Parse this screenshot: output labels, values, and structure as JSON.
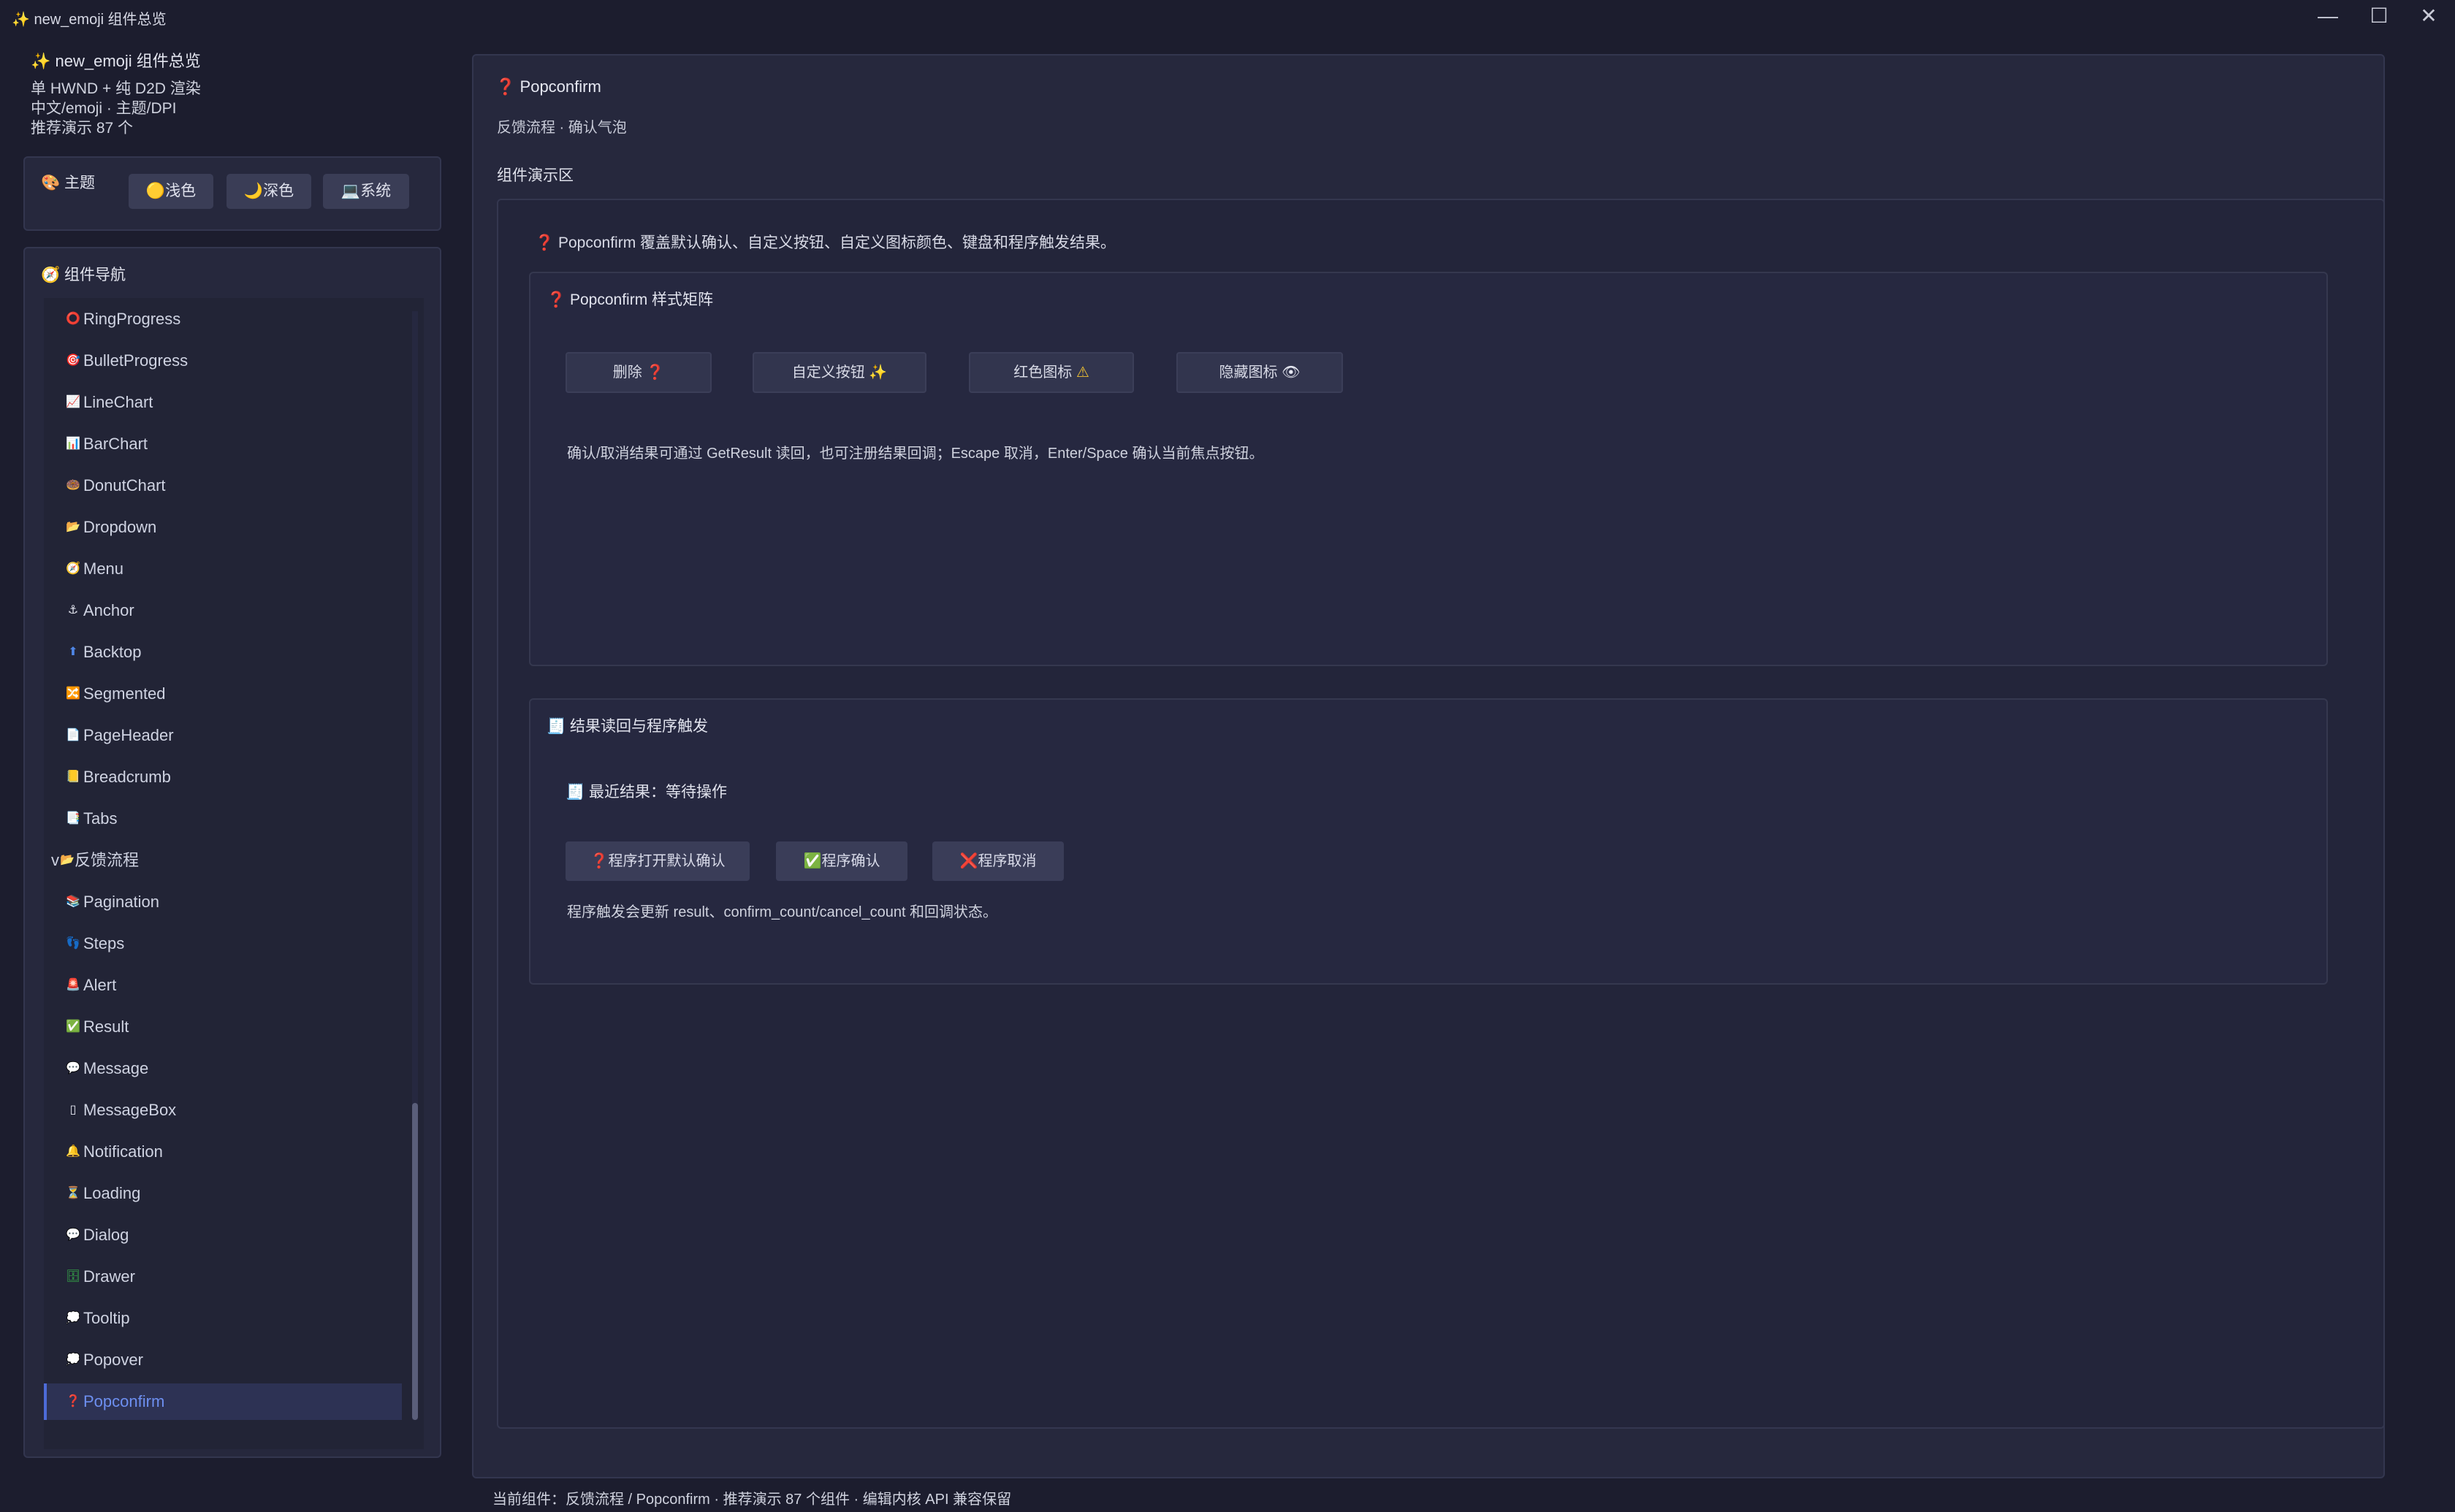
{
  "window": {
    "title": "new_emoji 组件总览",
    "title_icon": "✨",
    "controls": {
      "minimize": "—",
      "maximize": "☐",
      "close": "✕"
    }
  },
  "sidebar": {
    "app_title": "new_emoji 组件总览",
    "app_icon": "✨",
    "info_lines": [
      "单 HWND + 纯 D2D 渲染",
      "中文/emoji · 主题/DPI",
      "推荐演示 87 个"
    ],
    "theme": {
      "label": "主题",
      "icon": "🎨",
      "buttons": [
        {
          "label": "浅色",
          "icon": "🟡"
        },
        {
          "label": "深色",
          "icon": "🌙"
        },
        {
          "label": "系统",
          "icon": "💻"
        }
      ]
    },
    "nav": {
      "title": "组件导航",
      "icon": "🧭",
      "items": [
        {
          "label": "RingProgress",
          "icon": "⭕"
        },
        {
          "label": "BulletProgress",
          "icon": "🎯"
        },
        {
          "label": "LineChart",
          "icon": "📈"
        },
        {
          "label": "BarChart",
          "icon": "📊"
        },
        {
          "label": "DonutChart",
          "icon": "🍩"
        },
        {
          "label": "Dropdown",
          "icon": "📂"
        },
        {
          "label": "Menu",
          "icon": "🧭"
        },
        {
          "label": "Anchor",
          "icon": "⚓"
        },
        {
          "label": "Backtop",
          "icon": "⬆"
        },
        {
          "label": "Segmented",
          "icon": "🔀"
        },
        {
          "label": "PageHeader",
          "icon": "📄"
        },
        {
          "label": "Breadcrumb",
          "icon": "📒"
        },
        {
          "label": "Tabs",
          "icon": "📑"
        },
        {
          "label": "反馈流程",
          "icon": "📂",
          "group": true,
          "expander": "v"
        },
        {
          "label": "Pagination",
          "icon": "📚"
        },
        {
          "label": "Steps",
          "icon": "👣"
        },
        {
          "label": "Alert",
          "icon": "🚨"
        },
        {
          "label": "Result",
          "icon": "✅"
        },
        {
          "label": "Message",
          "icon": "💬"
        },
        {
          "label": "MessageBox",
          "icon": "▯"
        },
        {
          "label": "Notification",
          "icon": "🔔"
        },
        {
          "label": "Loading",
          "icon": "⏳"
        },
        {
          "label": "Dialog",
          "icon": "💬"
        },
        {
          "label": "Drawer",
          "icon": "🗄"
        },
        {
          "label": "Tooltip",
          "icon": "💭"
        },
        {
          "label": "Popover",
          "icon": "💭"
        },
        {
          "label": "Popconfirm",
          "icon": "❓",
          "active": true
        }
      ]
    }
  },
  "main": {
    "title": "Popconfirm",
    "title_icon": "❓",
    "subtitle": "反馈流程 · 确认气泡",
    "demo_label": "组件演示区",
    "intro": "Popconfirm 覆盖默认确认、自定义按钮、自定义图标颜色、键盘和程序触发结果。",
    "intro_icon": "❓",
    "style_card": {
      "title": "Popconfirm 样式矩阵",
      "icon": "❓",
      "buttons": [
        {
          "label": "删除",
          "icon": "❓"
        },
        {
          "label": "自定义按钮",
          "icon": "✨"
        },
        {
          "label": "红色图标",
          "icon": "⚠"
        },
        {
          "label": "隐藏图标",
          "icon": "👁"
        }
      ],
      "note": "确认/取消结果可通过 GetResult 读回，也可注册结果回调；Escape 取消，Enter/Space 确认当前焦点按钮。"
    },
    "result_card": {
      "title": "结果读回与程序触发",
      "icon": "🧾",
      "latest": "最近结果：等待操作",
      "latest_icon": "🧾",
      "buttons": [
        {
          "label": "程序打开默认确认",
          "icon": "❓"
        },
        {
          "label": "程序确认",
          "icon": "✅"
        },
        {
          "label": "程序取消",
          "icon": "❌"
        }
      ],
      "note": "程序触发会更新 result、confirm_count/cancel_count 和回调状态。"
    }
  },
  "status_bar": "当前组件：反馈流程 / Popconfirm · 推荐演示 87 个组件 · 编辑内核 API 兼容保留"
}
